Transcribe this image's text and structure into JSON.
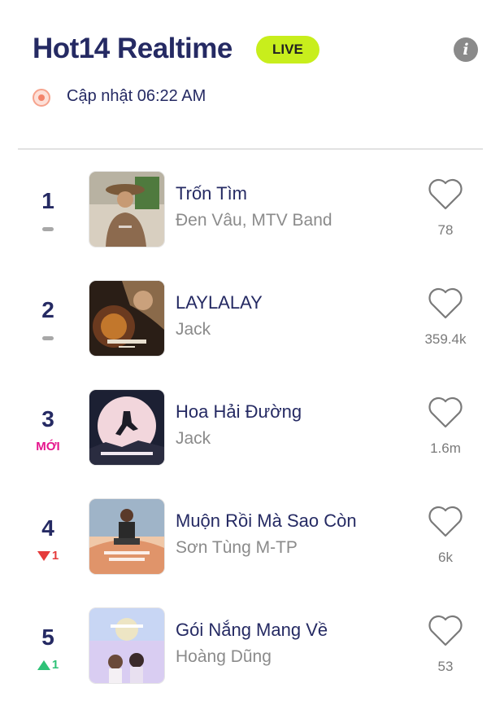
{
  "header": {
    "title": "Hot14 Realtime",
    "live_badge": "LIVE",
    "info_icon": "info-icon",
    "update_text": "Cập nhật 06:22 AM"
  },
  "colors": {
    "title": "#252a63",
    "live_badge_bg": "#c8ee1c",
    "new_label": "#e5158d",
    "down": "#e53b3b",
    "up": "#2ec277"
  },
  "chart_rows": [
    {
      "rank": "1",
      "change_type": "same",
      "change_text": "",
      "song": "Trốn Tìm",
      "artist": "Đen Vâu, MTV Band",
      "likes": "78"
    },
    {
      "rank": "2",
      "change_type": "same",
      "change_text": "",
      "song": "LAYLALAY",
      "artist": "Jack",
      "likes": "359.4k"
    },
    {
      "rank": "3",
      "change_type": "new",
      "change_text": "MỚI",
      "song": "Hoa Hải Đường",
      "artist": "Jack",
      "likes": "1.6m"
    },
    {
      "rank": "4",
      "change_type": "down",
      "change_text": "1",
      "song": "Muộn Rồi Mà Sao Còn",
      "artist": "Sơn Tùng M-TP",
      "likes": "6k"
    },
    {
      "rank": "5",
      "change_type": "up",
      "change_text": "1",
      "song": "Gói Nắng Mang Về",
      "artist": "Hoàng Dũng",
      "likes": "53"
    }
  ]
}
